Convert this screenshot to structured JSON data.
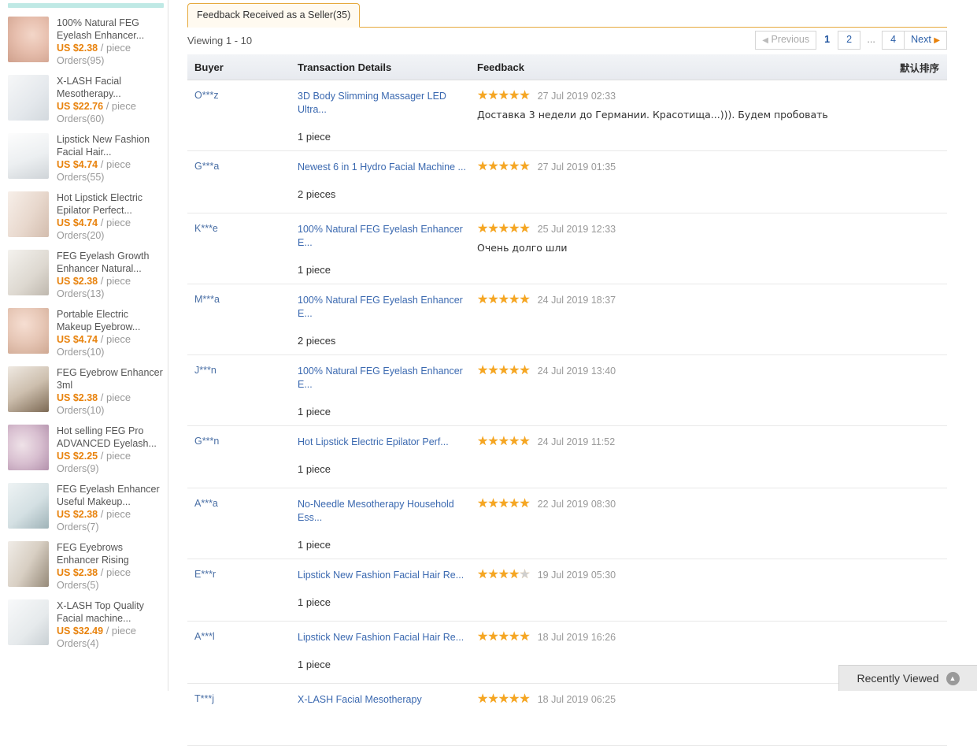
{
  "sidebar": {
    "products": [
      {
        "title": "100% Natural FEG Eyelash Enhancer...",
        "price": "US $2.38",
        "unit": "/ piece",
        "orders": "Orders(95)"
      },
      {
        "title": "X-LASH Facial Mesotherapy...",
        "price": "US $22.76",
        "unit": "/ piece",
        "orders": "Orders(60)"
      },
      {
        "title": "Lipstick New Fashion Facial Hair...",
        "price": "US $4.74",
        "unit": "/ piece",
        "orders": "Orders(55)"
      },
      {
        "title": "Hot Lipstick Electric Epilator Perfect...",
        "price": "US $4.74",
        "unit": "/ piece",
        "orders": "Orders(20)"
      },
      {
        "title": "FEG Eyelash Growth Enhancer Natural...",
        "price": "US $2.38",
        "unit": "/ piece",
        "orders": "Orders(13)"
      },
      {
        "title": "Portable Electric Makeup Eyebrow...",
        "price": "US $4.74",
        "unit": "/ piece",
        "orders": "Orders(10)"
      },
      {
        "title": "FEG Eyebrow Enhancer 3ml",
        "price": "US $2.38",
        "unit": "/ piece",
        "orders": "Orders(10)"
      },
      {
        "title": "Hot selling FEG Pro ADVANCED Eyelash...",
        "price": "US $2.25",
        "unit": "/ piece",
        "orders": "Orders(9)"
      },
      {
        "title": "FEG Eyelash Enhancer Useful Makeup...",
        "price": "US $2.38",
        "unit": "/ piece",
        "orders": "Orders(7)"
      },
      {
        "title": "FEG Eyebrows Enhancer Rising",
        "price": "US $2.38",
        "unit": "/ piece",
        "orders": "Orders(5)"
      },
      {
        "title": "X-LASH Top Quality Facial machine...",
        "price": "US $32.49",
        "unit": "/ piece",
        "orders": "Orders(4)"
      }
    ]
  },
  "main": {
    "tab_label": "Feedback Received as a Seller(35)",
    "viewing": "Viewing 1 - 10",
    "sort_label": "默认排序",
    "pager": {
      "previous": "Previous",
      "next": "Next",
      "pages": [
        "1",
        "2",
        "...",
        "4"
      ],
      "current": "1"
    },
    "columns": {
      "buyer": "Buyer",
      "transaction": "Transaction Details",
      "feedback": "Feedback"
    },
    "rows": [
      {
        "buyer": "O***z",
        "product": "3D Body Slimming Massager LED Ultra...",
        "qty": "1 piece",
        "rating": 5,
        "date": "27 Jul 2019 02:33",
        "comment": "Доставка 3 недели до Германии. Красотища...))). Будем пробовать"
      },
      {
        "buyer": "G***a",
        "product": "Newest 6 in 1 Hydro Facial Machine ...",
        "qty": "2 pieces",
        "rating": 5,
        "date": "27 Jul 2019 01:35",
        "comment": ""
      },
      {
        "buyer": "K***e",
        "product": "100% Natural FEG Eyelash Enhancer E...",
        "qty": "1 piece",
        "rating": 5,
        "date": "25 Jul 2019 12:33",
        "comment": "Очень долго шли"
      },
      {
        "buyer": "M***a",
        "product": "100% Natural FEG Eyelash Enhancer E...",
        "qty": "2 pieces",
        "rating": 5,
        "date": "24 Jul 2019 18:37",
        "comment": ""
      },
      {
        "buyer": "J***n",
        "product": "100% Natural FEG Eyelash Enhancer E...",
        "qty": "1 piece",
        "rating": 5,
        "date": "24 Jul 2019 13:40",
        "comment": ""
      },
      {
        "buyer": "G***n",
        "product": "Hot Lipstick Electric Epilator Perf...",
        "qty": "1 piece",
        "rating": 5,
        "date": "24 Jul 2019 11:52",
        "comment": ""
      },
      {
        "buyer": "A***a",
        "product": "No-Needle Mesotherapy Household Ess...",
        "qty": "1 piece",
        "rating": 5,
        "date": "22 Jul 2019 08:30",
        "comment": ""
      },
      {
        "buyer": "E***r",
        "product": "Lipstick New Fashion Facial Hair Re...",
        "qty": "1 piece",
        "rating": 4,
        "date": "19 Jul 2019 05:30",
        "comment": ""
      },
      {
        "buyer": "A***l",
        "product": "Lipstick New Fashion Facial Hair Re...",
        "qty": "1 piece",
        "rating": 5,
        "date": "18 Jul 2019 16:26",
        "comment": ""
      },
      {
        "buyer": "T***j",
        "product": "X-LASH Facial Mesotherapy",
        "qty": "",
        "rating": 5,
        "date": "18 Jul 2019 06:25",
        "comment": ""
      }
    ]
  },
  "recently_viewed": {
    "label": "Recently Viewed",
    "caret_icon": "chevron-up-icon"
  },
  "colors": {
    "price": "#e8820c",
    "link": "#3b69b0",
    "star": "#f5a623",
    "star_off": "#cfcfcf",
    "tab_border": "#e6a93c",
    "sidebar_accent": "#bfe9e5"
  }
}
